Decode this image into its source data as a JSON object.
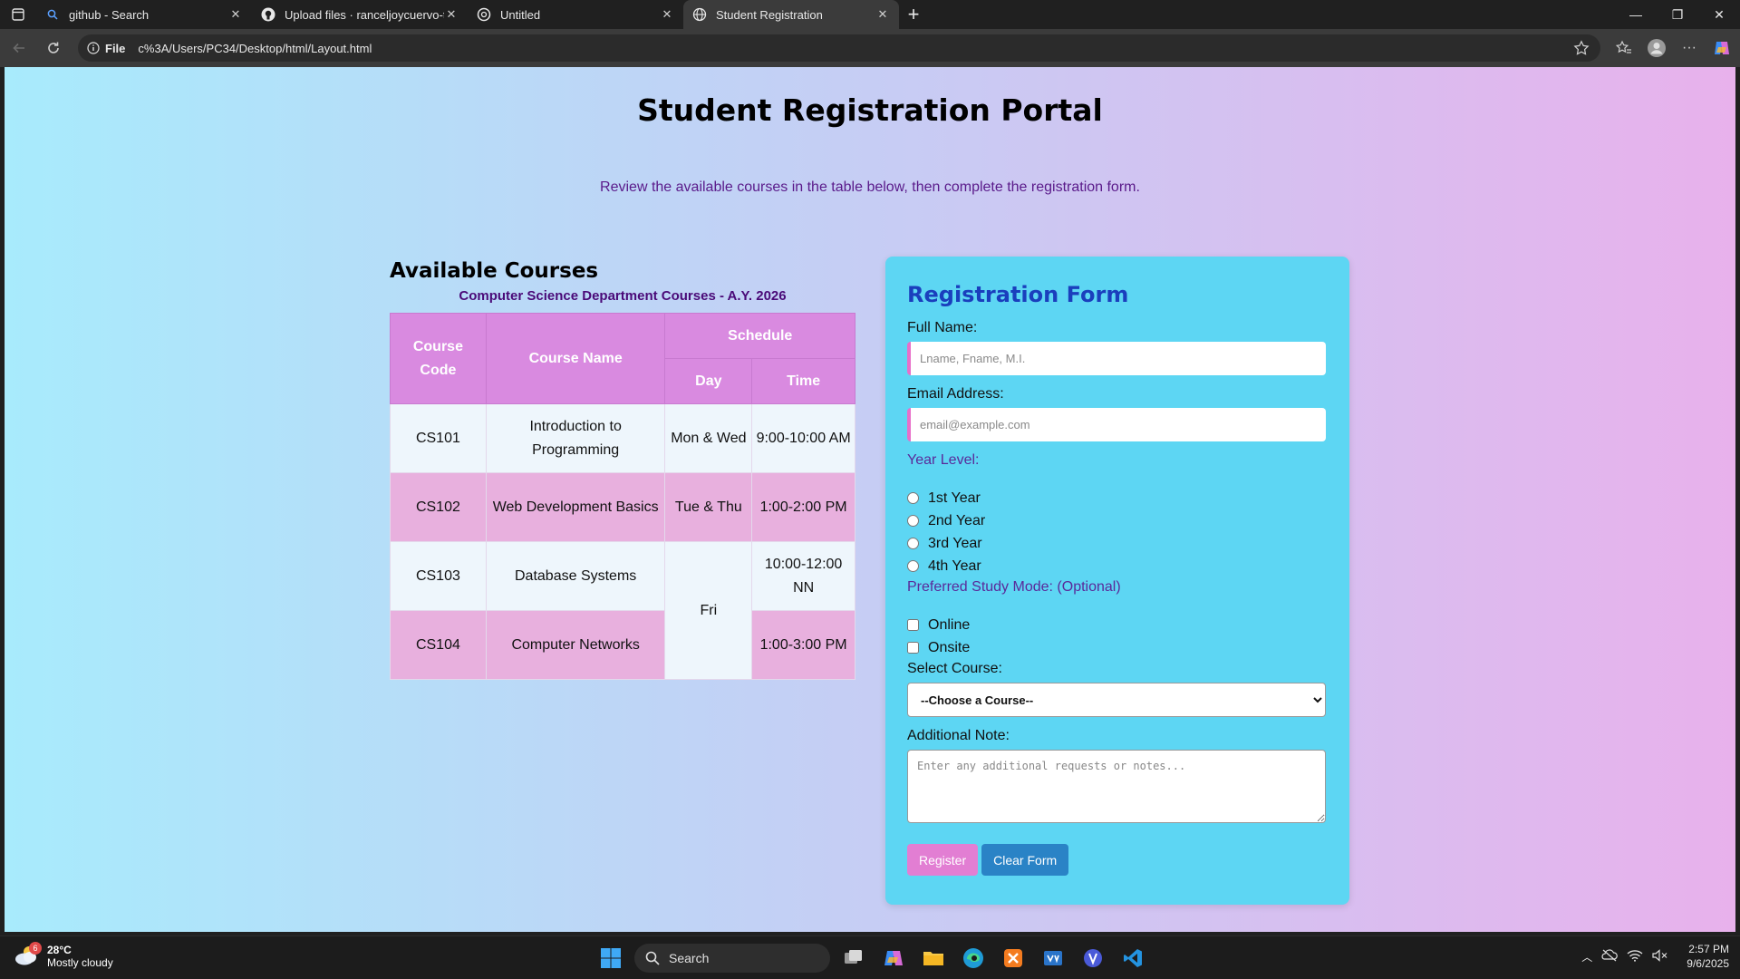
{
  "browser": {
    "tabs": [
      {
        "title": "github - Search",
        "active": false
      },
      {
        "title": "Upload files · ranceljoycuervo-tec",
        "active": false
      },
      {
        "title": "Untitled",
        "active": false
      },
      {
        "title": "Student Registration",
        "active": true
      }
    ],
    "address": {
      "scheme": "File",
      "url": "c%3A/Users/PC34/Desktop/html/Layout.html"
    }
  },
  "page": {
    "title": "Student Registration Portal",
    "subtitle": "Review the available courses in the table below, then complete the registration form."
  },
  "courses": {
    "heading": "Available Courses",
    "caption": "Computer Science Department Courses - A.Y. 2026",
    "headers": {
      "code": "Course Code",
      "name": "Course Name",
      "schedule": "Schedule",
      "day": "Day",
      "time": "Time"
    },
    "rows": [
      {
        "code": "CS101",
        "name": "Introduction to Programming",
        "day": "Mon & Wed",
        "time": "9:00-10:00 AM"
      },
      {
        "code": "CS102",
        "name": "Web Development Basics",
        "day": "Tue & Thu",
        "time": "1:00-2:00 PM"
      },
      {
        "code": "CS103",
        "name": "Database Systems",
        "day": "Fri",
        "time": "10:00-12:00 NN"
      },
      {
        "code": "CS104",
        "name": "Computer Networks",
        "day": "",
        "time": "1:00-3:00 PM"
      }
    ]
  },
  "form": {
    "heading": "Registration Form",
    "full_name_label": "Full Name:",
    "full_name_placeholder": "Lname, Fname, M.I.",
    "email_label": "Email Address:",
    "email_placeholder": "email@example.com",
    "year_label": "Year Level:",
    "years": [
      "1st Year",
      "2nd Year",
      "3rd Year",
      "4th Year"
    ],
    "mode_label": "Preferred Study Mode: (Optional)",
    "modes": [
      "Online",
      "Onsite"
    ],
    "course_label": "Select Course:",
    "course_selected": "--Choose a Course--",
    "note_label": "Additional Note:",
    "note_placeholder": "Enter any additional requests or notes...",
    "register_label": "Register",
    "clear_label": "Clear Form"
  },
  "taskbar": {
    "weather_temp": "28°C",
    "weather_desc": "Mostly cloudy",
    "weather_badge": "6",
    "search_label": "Search",
    "time": "2:57 PM",
    "date": "9/6/2025"
  },
  "colors": {
    "gradient_left": "#a8ebfc",
    "gradient_right": "#e8b1ec",
    "table_header": "#d98ae0",
    "form_card": "#5dd6f3",
    "form_heading": "#1a3fbd",
    "register_button": "#e27ed3",
    "clear_button": "#2a83c6"
  }
}
